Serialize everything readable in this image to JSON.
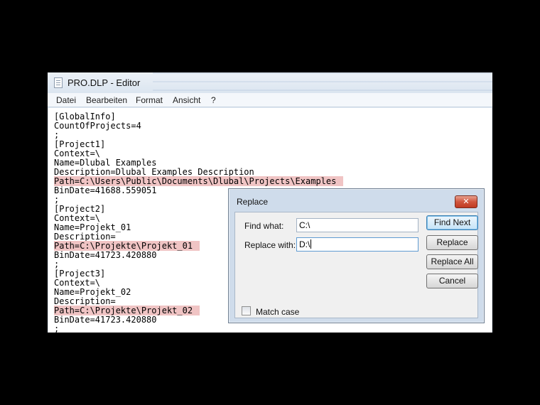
{
  "window": {
    "title": "PRO.DLP - Editor",
    "menu": [
      "Datei",
      "Bearbeiten",
      "Format",
      "Ansicht",
      "?"
    ]
  },
  "document": {
    "lines": [
      "[GlobalInfo]",
      "CountOfProjects=4",
      ";",
      "[Project1]",
      "Context=\\",
      "Name=Dlubal Examples",
      "Description=Dlubal Examples Description",
      "Path=C:\\Users\\Public\\Documents\\Dlubal\\Projects\\Examples",
      "BinDate=41688.559051",
      ";",
      "[Project2]",
      "Context=\\",
      "Name=Projekt_01",
      "Description=",
      "Path=C:\\Projekte\\Projekt_01",
      "BinDate=41723.420880",
      ";",
      "[Project3]",
      "Context=\\",
      "Name=Projekt_02",
      "Description=",
      "Path=C:\\Projekte\\Projekt_02",
      "BinDate=41723.420880",
      ";"
    ],
    "highlighted_lines": [
      7,
      14,
      21
    ],
    "highlight_color": "#f0c4c4"
  },
  "dialog": {
    "title": "Replace",
    "close_label": "✕",
    "find_label": "Find what:",
    "find_value": "C:\\",
    "replace_label": "Replace with:",
    "replace_value": "D:\\",
    "match_case_label": "Match case",
    "match_case_checked": false,
    "buttons": {
      "find_next": "Find Next",
      "replace": "Replace",
      "replace_all": "Replace All",
      "cancel": "Cancel"
    }
  }
}
